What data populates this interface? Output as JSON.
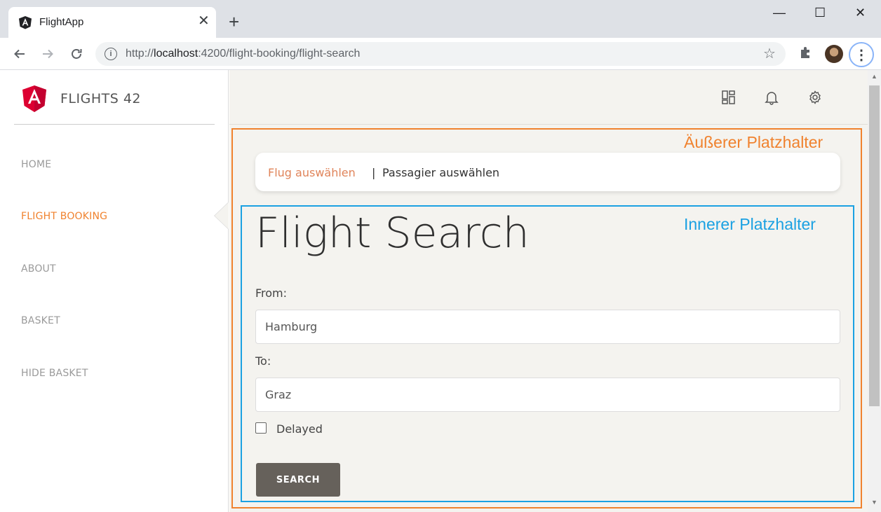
{
  "browser": {
    "tab_title": "FlightApp",
    "tab_close": "✕",
    "new_tab": "+",
    "url_prefix": "http://",
    "url_host": "localhost",
    "url_path": ":4200/flight-booking/flight-search",
    "window_controls": {
      "minimize": "—",
      "maximize": "☐",
      "close": "✕"
    }
  },
  "sidebar": {
    "brand": "FLIGHTS 42",
    "items": [
      {
        "label": "HOME",
        "active": false
      },
      {
        "label": "FLIGHT BOOKING",
        "active": true
      },
      {
        "label": "ABOUT",
        "active": false
      },
      {
        "label": "BASKET",
        "active": false
      },
      {
        "label": "HIDE BASKET",
        "active": false
      }
    ]
  },
  "topbar": {
    "icons": [
      "dashboard-icon",
      "bell-icon",
      "settings-icon"
    ]
  },
  "annotations": {
    "outer": "Äußerer Platzhalter",
    "inner": "Innerer Platzhalter"
  },
  "breadcrumb": {
    "item1": "Flug auswählen",
    "separator": "|",
    "item2": "Passagier auswählen"
  },
  "form": {
    "title": "Flight Search",
    "from_label": "From:",
    "from_value": "Hamburg",
    "to_label": "To:",
    "to_value": "Graz",
    "delayed_label": "Delayed",
    "delayed_checked": false,
    "search_label": "SEARCH"
  },
  "colors": {
    "accent": "#f0822e",
    "inner_annotation": "#1ba1e2",
    "button": "#66615b",
    "background": "#f4f3ef"
  }
}
